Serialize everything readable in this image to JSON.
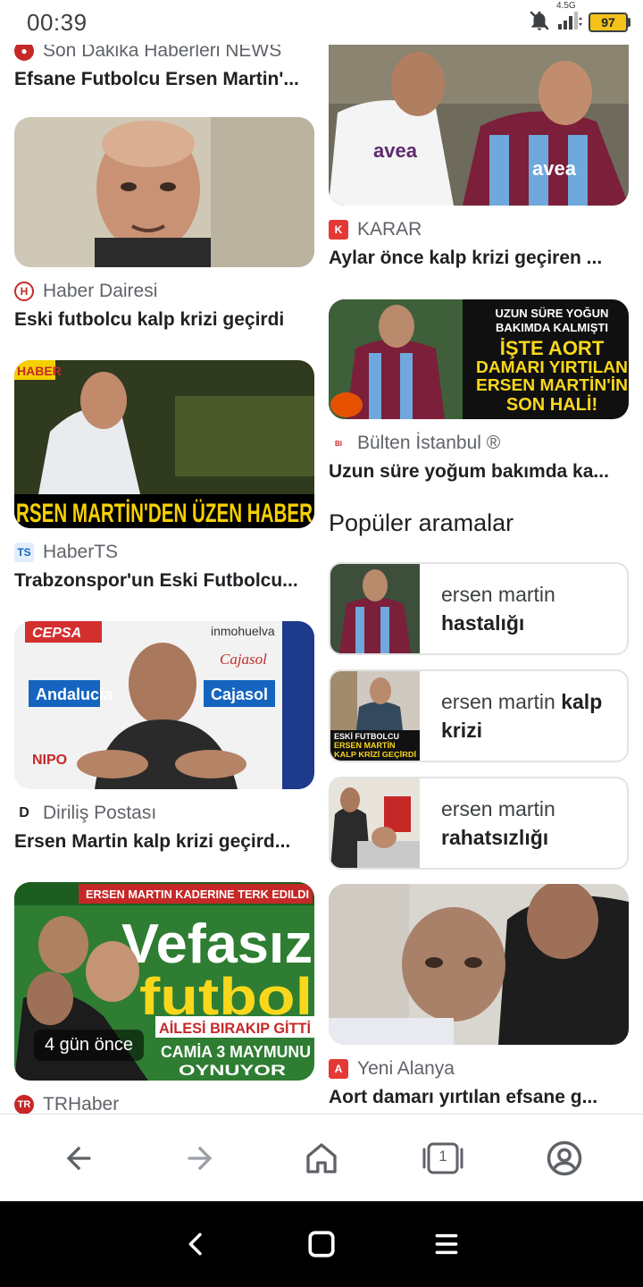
{
  "status": {
    "time": "00:39",
    "network": "4.5G",
    "battery": "97",
    "icons": [
      "bell-off-icon",
      "signal-icon",
      "battery-icon"
    ]
  },
  "cards_left": [
    {
      "source": "Son Dakika Haberleri NEWS",
      "title": "Efsane Futbolcu Ersen Martin'...",
      "has_image": false
    },
    {
      "source": "Haber Dairesi",
      "title": "Eski futbolcu kalp krizi geçirdi"
    },
    {
      "source": "HaberTS",
      "title": "Trabzonspor'un Eski Futbolcu...",
      "image_text": "RSEN MARTİN'DEN ÜZEN HABER",
      "image_corner": "HABER"
    },
    {
      "source": "Diriliş Postası",
      "title": "Ersen Martin kalp krizi geçird...",
      "image_signs": [
        "CEPSA",
        "inmohuelva",
        "Cajasol",
        "Andalucía",
        "Cajasol",
        "NIPO"
      ]
    },
    {
      "source": "TRHaber",
      "title": "",
      "image_top": "ERSEN MARTIN KADERINE TERK EDILDI",
      "image_big1": "Vefasız",
      "image_big2": "futbol",
      "image_line1": "AİLESİ BIRAKIP GİTTİ",
      "image_line2": "CAMİA 3 MAYMUNU",
      "image_line3": "OYNUYOR",
      "time_badge": "4 gün önce"
    }
  ],
  "cards_right": [
    {
      "source": "KARAR",
      "title": "Aylar önce kalp krizi geçiren ...",
      "image_text": "avea"
    },
    {
      "source": "Bülten İstanbul ®",
      "title": "Uzun süre yoğum bakımda ka...",
      "image_lines": [
        "UZUN SÜRE YOĞUN",
        "BAKIMDA KALMIŞTI",
        "İŞTE AORT",
        "DAMARI YIRTILAN",
        "ERSEN MARTİN'İN",
        "SON HALİ!"
      ]
    },
    {
      "source": "Yeni Alanya",
      "title": "Aort damarı yırtılan efsane g..."
    }
  ],
  "popular": {
    "title": "Popüler aramalar",
    "items": [
      {
        "prefix": "ersen martin",
        "bold": "hastalığı"
      },
      {
        "prefix": "ersen martin",
        "bold": "kalp krizi",
        "image_lines": [
          "ESKİ FUTBOLCU",
          "ERSEN MARTİN",
          "KALP KRİZİ GEÇİRDİ"
        ]
      },
      {
        "prefix": "ersen martin",
        "bold": "rahatsızlığı"
      }
    ]
  },
  "bottom_nav": {
    "tab_count": "1",
    "items": [
      "back-icon",
      "forward-icon",
      "home-icon",
      "tabs-icon",
      "account-icon"
    ]
  },
  "colors": {
    "accent_tab_yellow": "#f2c21b",
    "karar_red": "#e53935",
    "trabzon_bordo": "#7b1f3a",
    "trabzon_blue": "#6fa8dc"
  }
}
